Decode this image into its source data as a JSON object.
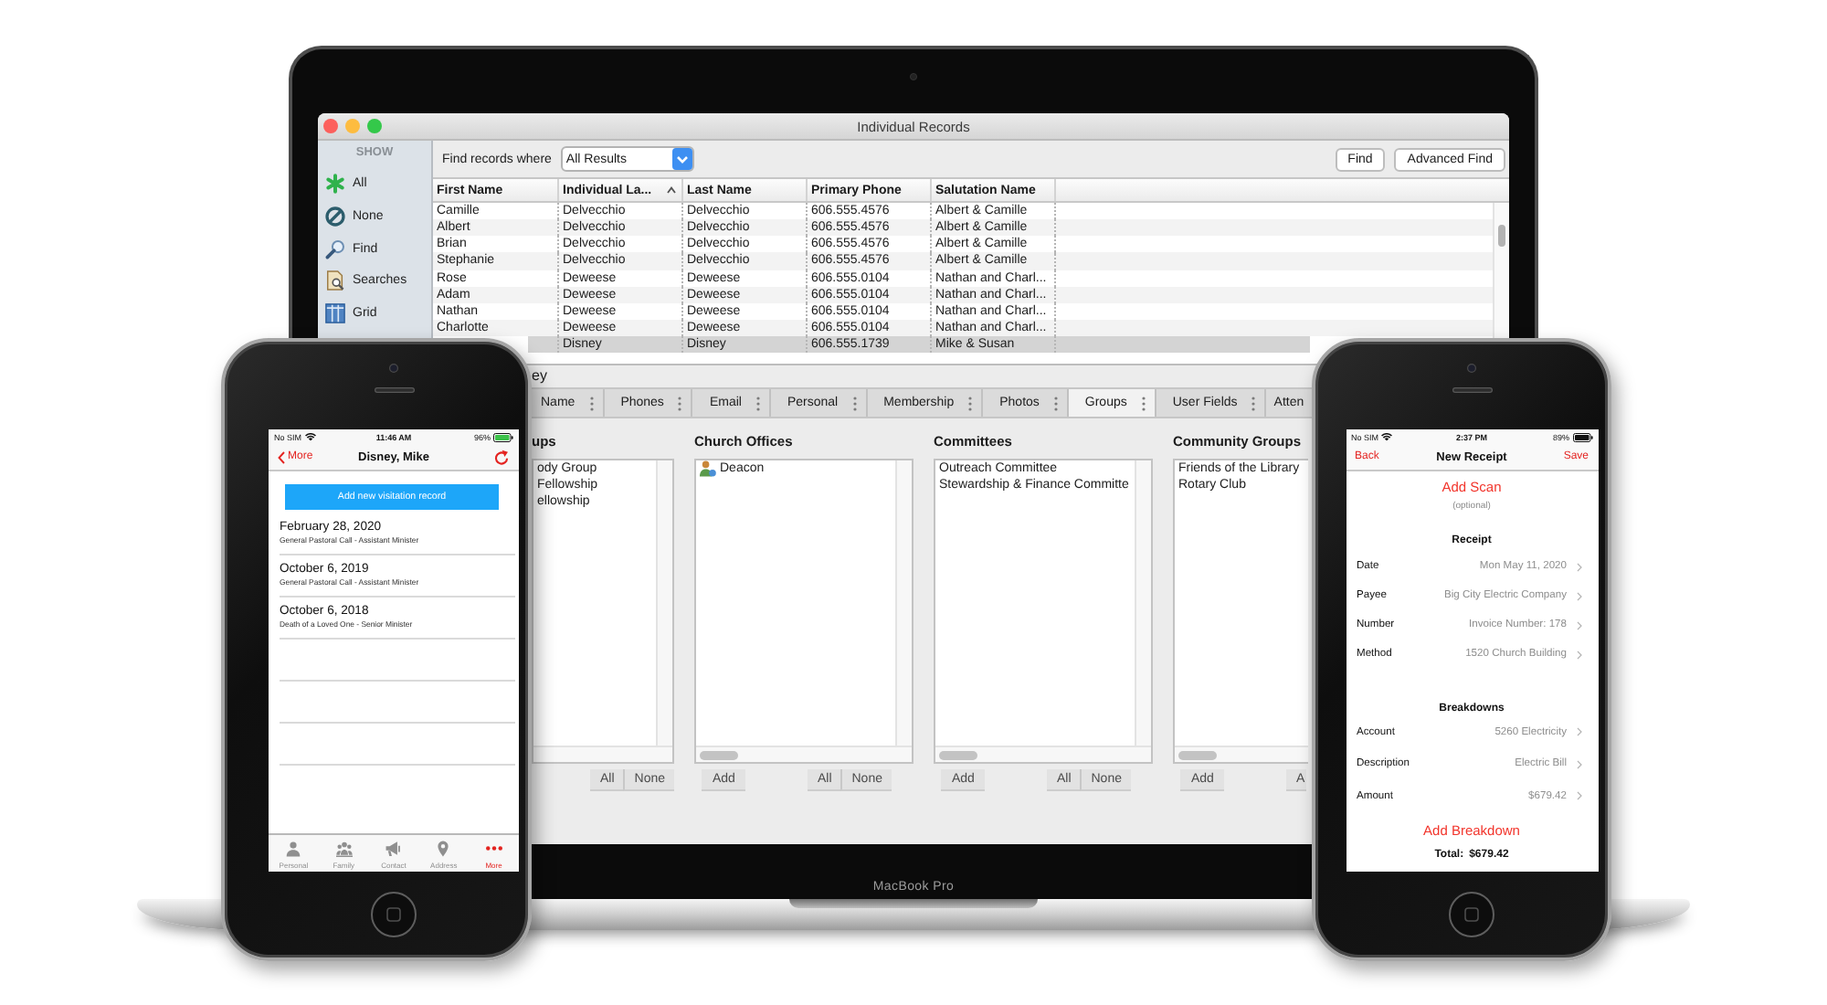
{
  "laptop": {
    "model_label": "MacBook Pro"
  },
  "window": {
    "title": "Individual Records"
  },
  "sidebar": {
    "heading": "SHOW",
    "items": [
      {
        "label": "All"
      },
      {
        "label": "None"
      },
      {
        "label": "Find"
      },
      {
        "label": "Searches"
      },
      {
        "label": "Grid"
      }
    ]
  },
  "find_bar": {
    "label": "Find records where",
    "filter": "All Results",
    "buttons": [
      "Find",
      "Advanced Find"
    ]
  },
  "table": {
    "columns": [
      {
        "label": "First Name",
        "sorted": false
      },
      {
        "label": "Individual La...",
        "sorted": true
      },
      {
        "label": "Last Name",
        "sorted": false
      },
      {
        "label": "Primary Phone",
        "sorted": false
      },
      {
        "label": "Salutation Name",
        "sorted": false
      }
    ],
    "rows": [
      {
        "cells": [
          "Camille",
          "Delvecchio",
          "Delvecchio",
          "606.555.4576",
          "Albert & Camille"
        ],
        "selected": false
      },
      {
        "cells": [
          "Albert",
          "Delvecchio",
          "Delvecchio",
          "606.555.4576",
          "Albert & Camille"
        ],
        "selected": false
      },
      {
        "cells": [
          "Brian",
          "Delvecchio",
          "Delvecchio",
          "606.555.4576",
          "Albert & Camille"
        ],
        "selected": false
      },
      {
        "cells": [
          "Stephanie",
          "Delvecchio",
          "Delvecchio",
          "606.555.4576",
          "Albert & Camille"
        ],
        "selected": false
      },
      {
        "cells": [
          "Rose",
          "Deweese",
          "Deweese",
          "606.555.0104",
          "Nathan and Charl..."
        ],
        "selected": false
      },
      {
        "cells": [
          "Adam",
          "Deweese",
          "Deweese",
          "606.555.0104",
          "Nathan and Charl..."
        ],
        "selected": false
      },
      {
        "cells": [
          "Nathan",
          "Deweese",
          "Deweese",
          "606.555.0104",
          "Nathan and Charl..."
        ],
        "selected": false
      },
      {
        "cells": [
          "Charlotte",
          "Deweese",
          "Deweese",
          "606.555.0104",
          "Nathan and Charl..."
        ],
        "selected": false
      },
      {
        "cells": [
          null,
          "Disney",
          "Disney",
          "606.555.1739",
          "Mike & Susan"
        ],
        "selected": true
      }
    ]
  },
  "record": {
    "heading": "ey",
    "tabs": [
      {
        "label": "Name",
        "selected": false
      },
      {
        "label": "Phones",
        "selected": false
      },
      {
        "label": "Email",
        "selected": false
      },
      {
        "label": "Personal",
        "selected": false
      },
      {
        "label": "Membership",
        "selected": false
      },
      {
        "label": "Photos",
        "selected": false
      },
      {
        "label": "Groups",
        "selected": true
      },
      {
        "label": "User Fields",
        "selected": false
      },
      {
        "label": "Atten",
        "selected": false
      }
    ],
    "panels": [
      {
        "heading": "ups",
        "items": [
          {
            "label": "ody Group",
            "kind": "group"
          },
          {
            "label": "Fellowship",
            "kind": "group"
          },
          {
            "label": "ellowship",
            "kind": "group"
          }
        ],
        "select_buttons": [
          "All",
          "None"
        ]
      },
      {
        "heading": "Church Offices",
        "items": [
          {
            "label": "Deacon",
            "kind": "office"
          }
        ],
        "add_button": "Add",
        "select_buttons": [
          "All",
          "None"
        ]
      },
      {
        "heading": "Committees",
        "items": [
          {
            "label": "Outreach Committee",
            "kind": "group"
          },
          {
            "label": "Stewardship & Finance Committe",
            "kind": "group"
          }
        ],
        "add_button": "Add",
        "select_buttons": [
          "All",
          "None"
        ]
      },
      {
        "heading": "Community Groups",
        "items": [
          {
            "label": "Friends of the Library",
            "kind": "group"
          },
          {
            "label": "Rotary Club",
            "kind": "group"
          }
        ],
        "add_button": "Add",
        "select_buttons": [
          "A"
        ]
      }
    ]
  },
  "visitation_phone": {
    "status_bar": {
      "carrier": "No SIM",
      "time": "11:46 AM",
      "battery": "96%"
    },
    "nav_bar": {
      "back": "More",
      "title": "Disney, Mike"
    },
    "action_button": "Add new visitation record",
    "visits": [
      {
        "date": "February 28, 2020",
        "description": "General Pastoral Call - Assistant Minister"
      },
      {
        "date": "October 6, 2019",
        "description": "General Pastoral Call - Assistant Minister"
      },
      {
        "date": "October 6, 2018",
        "description": "Death of a Loved One - Senior Minister"
      }
    ],
    "tabs": [
      {
        "label": "Personal",
        "selected": false
      },
      {
        "label": "Family",
        "selected": false
      },
      {
        "label": "Contact",
        "selected": false
      },
      {
        "label": "Address",
        "selected": false
      },
      {
        "label": "More",
        "selected": true
      }
    ]
  },
  "receipt_phone": {
    "status_bar": {
      "carrier": "No SIM",
      "time": "2:37 PM",
      "battery": "89%"
    },
    "nav_bar": {
      "back": "Back",
      "title": "New Receipt",
      "action": "Save"
    },
    "scan": {
      "link": "Add Scan",
      "hint": "(optional)"
    },
    "sections": [
      {
        "heading": "Receipt",
        "fields": [
          {
            "label": "Date",
            "value": "Mon May 11, 2020"
          },
          {
            "label": "Payee",
            "value": "Big City Electric Company"
          },
          {
            "label": "Number",
            "value": "Invoice Number: 178"
          },
          {
            "label": "Method",
            "value": "1520 Church Building"
          }
        ]
      },
      {
        "heading": "Breakdowns",
        "fields": [
          {
            "label": "Account",
            "value": "5260 Electricity"
          },
          {
            "label": "Description",
            "value": "Electric Bill"
          },
          {
            "label": "Amount",
            "value": "$679.42"
          }
        ]
      }
    ],
    "add_link": "Add Breakdown",
    "total": {
      "label": "Total:",
      "value": "$679.42"
    }
  }
}
